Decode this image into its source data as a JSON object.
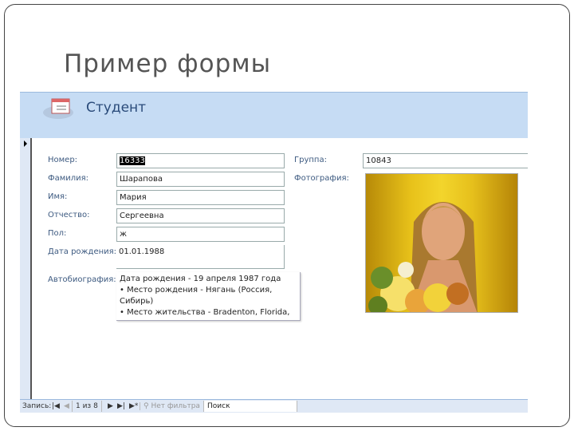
{
  "slide_title": "Пример формы",
  "form": {
    "title": "Студент",
    "fields": [
      {
        "label": "Номер:",
        "value": "16333"
      },
      {
        "label": "Фамилия:",
        "value": "Шарапова"
      },
      {
        "label": "Имя:",
        "value": "Мария"
      },
      {
        "label": "Отчество:",
        "value": "Сергеевна"
      },
      {
        "label": "Пол:",
        "value": "ж"
      },
      {
        "label": "Дата рождения:",
        "value": "01.01.1988"
      }
    ],
    "group": {
      "label": "Группа:",
      "value": "10843"
    },
    "photo_label": "Фотография:",
    "bio": {
      "label": "Автобиография:",
      "lines": [
        "Дата рождения - 19 апреля 1987 года",
        "• Место рождения - Нягань (Россия,",
        "Сибирь)",
        "• Место жительства - Bradenton, Florida,"
      ]
    }
  },
  "nav": {
    "records_label": "Запись:",
    "first": "|◀",
    "prev": "◀",
    "position": "1 из 8",
    "next": "▶",
    "last": "▶|",
    "new": "▶*",
    "filter": "Нет фильтра",
    "search": "Поиск"
  }
}
